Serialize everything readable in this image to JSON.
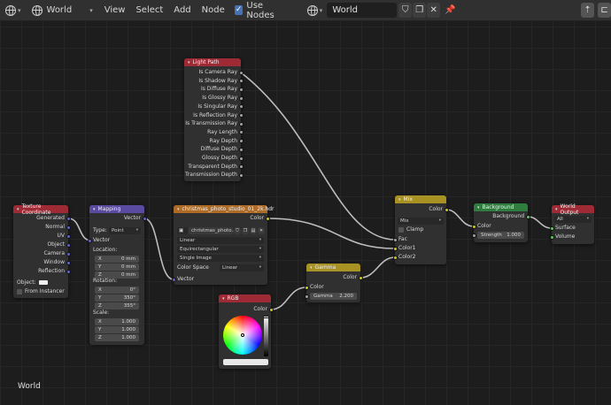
{
  "header": {
    "editor_type_icon": "node-editor-icon",
    "world_type_icon": "world-icon",
    "shader_type": "World",
    "menus": [
      "View",
      "Select",
      "Add",
      "Node"
    ],
    "use_nodes_label": "Use Nodes",
    "use_nodes_checked": true,
    "world_name": "World",
    "icons": [
      "fake-user-shield-icon",
      "new-copy-icon",
      "close-icon",
      "pin-icon",
      "parent-up-icon",
      "sidebar-icon"
    ]
  },
  "nodes": {
    "texture_coordinate": {
      "title": "Texture Coordinate",
      "outputs": [
        "Generated",
        "Normal",
        "UV",
        "Object",
        "Camera",
        "Window",
        "Reflection"
      ],
      "object_label": "Object:",
      "from_instancer": "From Instancer"
    },
    "mapping": {
      "title": "Mapping",
      "output": "Vector",
      "type_label": "Type:",
      "type_value": "Point",
      "vector_input": "Vector",
      "location_label": "Location:",
      "location": [
        {
          "k": "X",
          "v": "0 mm"
        },
        {
          "k": "Y",
          "v": "0 mm"
        },
        {
          "k": "Z",
          "v": "0 mm"
        }
      ],
      "rotation_label": "Rotation:",
      "rotation": [
        {
          "k": "X",
          "v": "0°"
        },
        {
          "k": "Y",
          "v": "350°"
        },
        {
          "k": "Z",
          "v": "355°"
        }
      ],
      "scale_label": "Scale:",
      "scale": [
        {
          "k": "X",
          "v": "1.000"
        },
        {
          "k": "Y",
          "v": "1.000"
        },
        {
          "k": "Z",
          "v": "1.000"
        }
      ]
    },
    "environment": {
      "title": "christmas_photo_studio_01_2k.hdr",
      "output": "Color",
      "image_name": "christmas_photo...",
      "interpolation": "Linear",
      "projection": "Equirectangular",
      "source": "Single Image",
      "color_space_label": "Color Space",
      "color_space": "Linear",
      "vector_input": "Vector"
    },
    "light_path": {
      "title": "Light Path",
      "outputs": [
        "Is Camera Ray",
        "Is Shadow Ray",
        "Is Diffuse Ray",
        "Is Glossy Ray",
        "Is Singular Ray",
        "Is Reflection Ray",
        "Is Transmission Ray",
        "Ray Length",
        "Ray Depth",
        "Diffuse Depth",
        "Glossy Depth",
        "Transparent Depth",
        "Transmission Depth"
      ]
    },
    "rgb": {
      "title": "RGB",
      "output": "Color"
    },
    "gamma": {
      "title": "Gamma",
      "output": "Color",
      "color_input": "Color",
      "gamma_label": "Gamma",
      "gamma_value": "2.200"
    },
    "mix": {
      "title": "Mix",
      "output": "Color",
      "blend_type": "Mix",
      "clamp_label": "Clamp",
      "inputs": [
        "Fac",
        "Color1",
        "Color2"
      ]
    },
    "background": {
      "title": "Background",
      "output": "Background",
      "color_input": "Color",
      "strength_label": "Strength",
      "strength_value": "1.000"
    },
    "world_output": {
      "title": "World Output",
      "target": "All",
      "inputs": [
        "Surface",
        "Volume"
      ]
    }
  },
  "footer": {
    "context_label": "World"
  }
}
